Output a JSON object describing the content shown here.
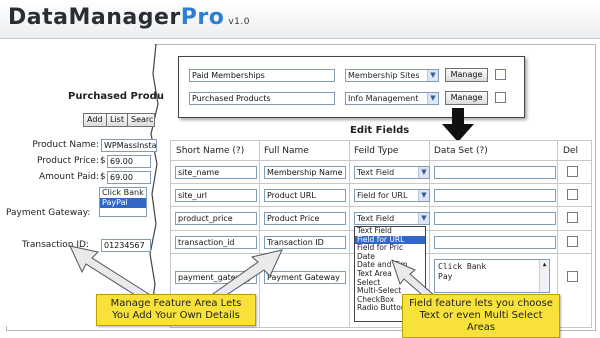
{
  "app": {
    "brand_main": "DataManager",
    "brand_pro": "Pro",
    "version": "v1.0"
  },
  "left": {
    "title": "Purchased Produ",
    "buttons": [
      "Add",
      "List",
      "Searc"
    ],
    "product_name_label": "Product Name:",
    "product_name_value": "WPMassInstalle",
    "product_price_label": "Product Price:",
    "currency": "$",
    "product_price_value": "69.00",
    "amount_paid_label": "Amount Paid:",
    "amount_paid_value": "69.00",
    "payment_gateway_label": "Payment Gateway:",
    "payment_options": [
      "Click Bank",
      "PayPal"
    ],
    "payment_selected": "PayPal",
    "transaction_label": "Transaction ID:",
    "transaction_value": "01234567"
  },
  "features": {
    "rows": [
      {
        "name": "Paid Memberships",
        "category": "Membership Sites",
        "action": "Manage"
      },
      {
        "name": "Purchased Products",
        "category": "Info Management",
        "action": "Manage"
      }
    ]
  },
  "edit_fields": {
    "title": "Edit Fields",
    "columns": [
      "Short Name (?)",
      "Full Name",
      "Feild Type",
      "Data Set (?)",
      "Del"
    ],
    "rows": [
      {
        "short": "site_name",
        "full": "Membership Name",
        "type": "Text Field"
      },
      {
        "short": "site_url",
        "full": "Product URL",
        "type": "Field for URL"
      },
      {
        "short": "product_price",
        "full": "Product Price",
        "type": "Text Field"
      },
      {
        "short": "transaction_id",
        "full": "Transaction ID",
        "type": "Text Field"
      },
      {
        "short": "payment_gateway",
        "full": "Payment Gateway",
        "type": ""
      }
    ],
    "dropdown_options": [
      "Text Field",
      "Field for URL",
      "Field for Pric",
      "Date",
      "Date and Tim",
      "Text Area",
      "Select",
      "Multi-Select",
      "CheckBox",
      "Radio Buttons"
    ],
    "dropdown_selected": "Field for URL",
    "dataset_lines": [
      "Click Bank",
      "Pay"
    ]
  },
  "callouts": {
    "left": "Manage Feature Area Lets You Add Your Own Details",
    "right": "Field feature lets you choose Text or even Multi Select Areas"
  }
}
